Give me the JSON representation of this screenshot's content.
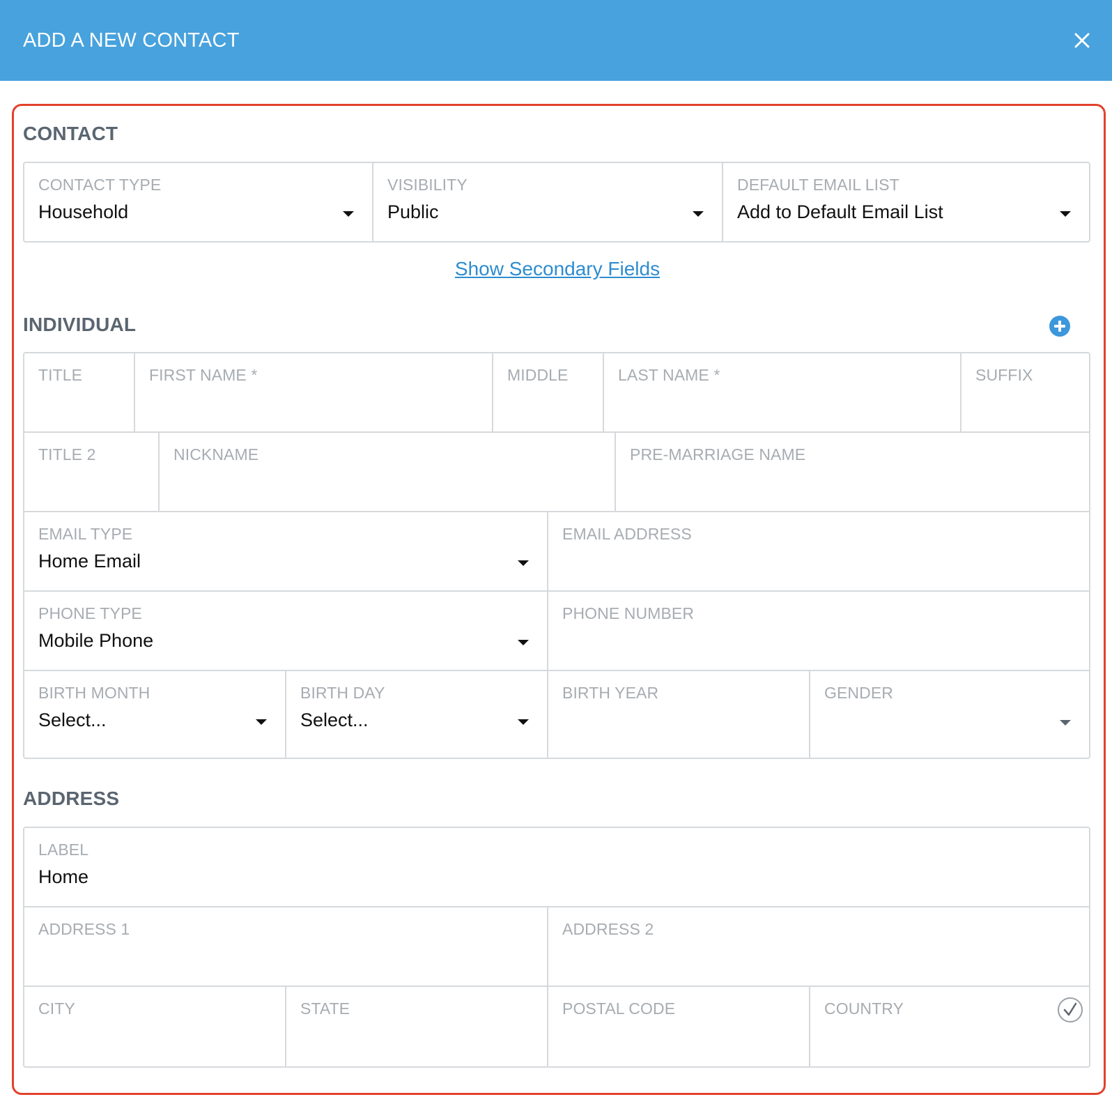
{
  "dialog": {
    "title": "ADD A NEW CONTACT",
    "close_icon": "close-icon"
  },
  "contact": {
    "section_title": "CONTACT",
    "contact_type": {
      "label": "CONTACT TYPE",
      "value": "Household"
    },
    "visibility": {
      "label": "VISIBILITY",
      "value": "Public"
    },
    "default_email_list": {
      "label": "DEFAULT EMAIL LIST",
      "value": "Add to Default Email List"
    },
    "show_secondary_link": "Show Secondary Fields"
  },
  "individual": {
    "section_title": "INDIVIDUAL",
    "add_icon": "plus-circle-icon",
    "title": {
      "label": "TITLE"
    },
    "first_name": {
      "label": "FIRST NAME *"
    },
    "middle": {
      "label": "MIDDLE"
    },
    "last_name": {
      "label": "LAST NAME *"
    },
    "suffix": {
      "label": "SUFFIX"
    },
    "title2": {
      "label": "TITLE 2"
    },
    "nickname": {
      "label": "NICKNAME"
    },
    "pre_marriage_name": {
      "label": "PRE-MARRIAGE NAME"
    },
    "email_type": {
      "label": "EMAIL TYPE",
      "value": "Home Email"
    },
    "email_address": {
      "label": "EMAIL ADDRESS"
    },
    "phone_type": {
      "label": "PHONE TYPE",
      "value": "Mobile Phone"
    },
    "phone_number": {
      "label": "PHONE NUMBER"
    },
    "birth_month": {
      "label": "BIRTH MONTH",
      "value": "Select..."
    },
    "birth_day": {
      "label": "BIRTH DAY",
      "value": "Select..."
    },
    "birth_year": {
      "label": "BIRTH YEAR"
    },
    "gender": {
      "label": "GENDER",
      "value": ""
    }
  },
  "address": {
    "section_title": "ADDRESS",
    "label_field": {
      "label": "LABEL",
      "value": "Home"
    },
    "address1": {
      "label": "ADDRESS 1"
    },
    "address2": {
      "label": "ADDRESS 2"
    },
    "city": {
      "label": "CITY"
    },
    "state": {
      "label": "STATE"
    },
    "postal_code": {
      "label": "POSTAL CODE"
    },
    "country": {
      "label": "COUNTRY",
      "status_icon": "checkmark-circle-icon"
    }
  },
  "colors": {
    "header_bg": "#47a2dd",
    "highlight_border": "#e2422c",
    "link": "#2e8ccf",
    "accent": "#3d97db"
  }
}
